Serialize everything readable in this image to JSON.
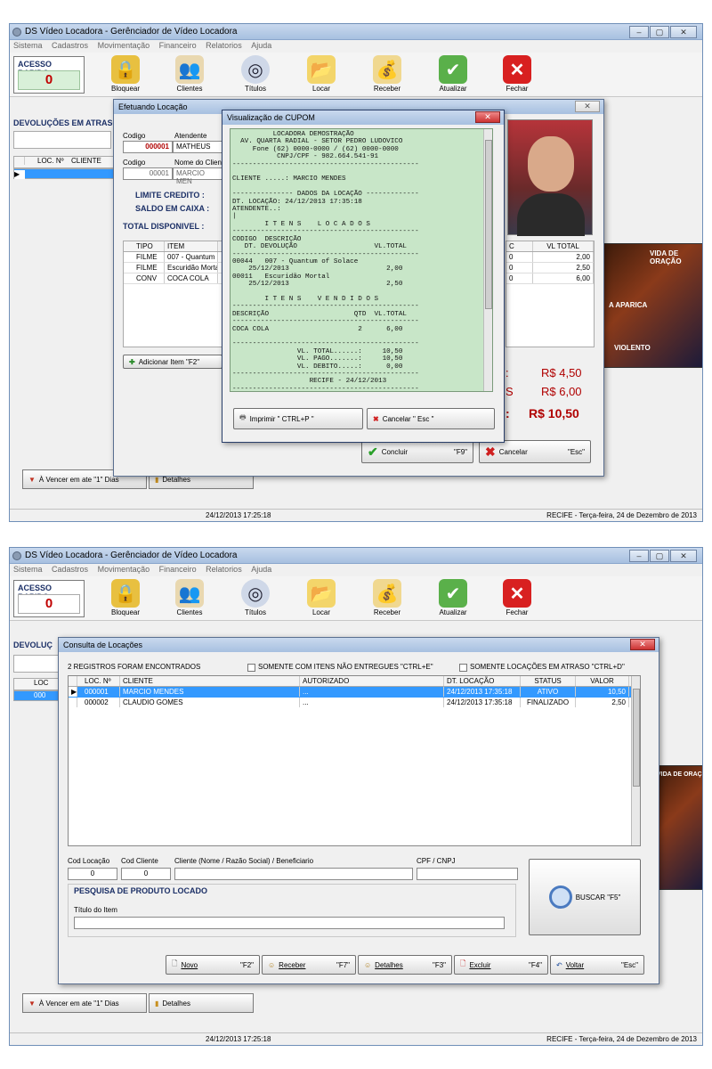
{
  "app": {
    "title": "DS Vídeo Locadora - Gerênciador de Vídeo Locadora",
    "menu": [
      "Sistema",
      "Cadastros",
      "Movimentação",
      "Financeiro",
      "Relatorios",
      "Ajuda"
    ],
    "acesso_rapido_label": "ACESSO RAPIDO",
    "acesso_rapido_value": "0",
    "toolbar": [
      {
        "label": "Bloquear",
        "icon": "padlock-icon"
      },
      {
        "label": "Clientes",
        "icon": "users-icon"
      },
      {
        "label": "Títulos",
        "icon": "dvd-icon"
      },
      {
        "label": "Locar",
        "icon": "folder-icon"
      },
      {
        "label": "Receber",
        "icon": "coins-icon"
      },
      {
        "label": "Atualizar",
        "icon": "shield-check-icon"
      },
      {
        "label": "Fechar",
        "icon": "close-x-icon"
      }
    ],
    "win_buttons": [
      "–",
      "▢",
      "✕"
    ],
    "status_datetime": "24/12/2013 17:25:18",
    "status_location": "RECIFE - Terça-feira, 24 de Dezembro de 2013",
    "left_panel_title": "DEVOLUÇÕES EM ATRASO",
    "left_panel_title_short": "DEVOLUÇ",
    "left_grid_headers": [
      "LOC. Nº",
      "CLIENTE"
    ],
    "left_grid_headers_short": "LOC",
    "left_grid_cell_short": "000",
    "vencer_btn": "À Vencer em ate \"1\" Dias",
    "detalhes_btn": "Detalhes"
  },
  "locacao": {
    "title": "Efetuando Locação",
    "close": "✕",
    "codigo_label": "Codigo",
    "atendente_label": "Atendente",
    "codigo_value": "000001",
    "atendente_value": "MATHEUS",
    "codigo2_label": "Codigo",
    "nome_label": "Nome do Clien",
    "codigo2_value": "00001",
    "nome_value": "MARCIO MEN",
    "limite_label": "LIMITE CREDITO :",
    "saldo_label": "SALDO EM CAIXA :",
    "disponivel_label": "TOTAL DISPONIVEL :",
    "grid_headers": [
      "TIPO",
      "ITEM"
    ],
    "rows": [
      {
        "tipo": "FILME",
        "item": "007 - Quantum o"
      },
      {
        "tipo": "FILME",
        "item": "Escuridão Morta"
      },
      {
        "tipo": "CONV",
        "item": "COCA COLA"
      }
    ],
    "right_headers": [
      "C",
      "VL TOTAL"
    ],
    "right_rows": [
      {
        "c": "0",
        "v": "2,00"
      },
      {
        "c": "0",
        "v": "2,50"
      },
      {
        "c": "0",
        "v": "6,00"
      }
    ],
    "adicionar_label": "Adicionar Item   \"F2\"",
    "tot1_prefix": ":",
    "tot1": "R$ 4,50",
    "tot2_prefix": "S",
    "tot2": "R$ 6,00",
    "tot3_prefix": ":",
    "tot3": "R$ 10,50",
    "concluir_label": "Concluir",
    "concluir_key": "\"F9\"",
    "cancelar_label": "Cancelar",
    "cancelar_key": "\"Esc\""
  },
  "cupom": {
    "title": "Visualização de CUPOM",
    "lines": [
      "          LOCADORA DEMOSTRAÇÃO",
      "  AV. QUARTA RADIAL - SETOR PEDRO LUDOVICO",
      "     Fone (62) 0000-0000 / (62) 0000-0000",
      "           CNPJ/CPF - 982.664.541-91",
      "----------------------------------------------",
      "",
      "CLIENTE .....: MARCIO MENDES",
      "",
      "--------------- DADOS DA LOCAÇÃO -------------",
      "DT. LOCAÇÃO: 24/12/2013 17:35:18",
      "ATENDENTE..:",
      "|",
      "        I T E N S    L O C A D O S",
      "----------------------------------------------",
      "CODIGO  DESCRIÇÃO",
      "   DT. DEVOLUÇÃO                   VL.TOTAL",
      "----------------------------------------------",
      "00044   007 - Quantum of Solace",
      "    25/12/2013                        2,00",
      "00011   Escuridão Mortal",
      "    25/12/2013                        2,50",
      "",
      "        I T E N S    V E N D I D O S",
      "----------------------------------------------",
      "DESCRIÇÃO                     QTD  VL.TOTAL",
      "----------------------------------------------",
      "COCA COLA                      2      6,00",
      "",
      "----------------------------------------------",
      "                VL. TOTAL......:     10,50",
      "                VL. PAGO.......:     10,50",
      "                VL. DEBITO.....:      0,00",
      "----------------------------------------------",
      "                   RECIFE - 24/12/2013",
      "----------------------------------------------"
    ],
    "imprimir": "Imprimir \" CTRL+P \"",
    "cancelar": "Cancelar \" Esc \""
  },
  "consulta": {
    "title": "Consulta de Locações",
    "registros": "2 REGISTROS FORAM ENCONTRADOS",
    "chk1": "SOMENTE COM ITENS NÃO ENTREGUES  \"CTRL+E\"",
    "chk2": "SOMENTE LOCAÇÕES EM ATRASO \"CTRL+D\"",
    "headers": [
      "LOC. Nº",
      "CLIENTE",
      "AUTORIZADO",
      "DT. LOCAÇÃO",
      "STATUS",
      "VALOR"
    ],
    "rows": [
      {
        "loc": "000001",
        "cliente": "MARCIO MENDES",
        "aut": "...",
        "dt": "24/12/2013 17:35:18",
        "status": "ATIVO",
        "valor": "10,50"
      },
      {
        "loc": "000002",
        "cliente": "CLAUDIO GOMES",
        "aut": "...",
        "dt": "24/12/2013 17:35:18",
        "status": "FINALIZADO",
        "valor": "2,50"
      }
    ],
    "cod_locacao_label": "Cod Locação",
    "cod_cliente_label": "Cod Cliente",
    "cliente_label": "Cliente (Nome / Razão Social) / Beneficiario",
    "cpf_label": "CPF / CNPJ",
    "cod_locacao_value": "0",
    "cod_cliente_value": "0",
    "pesquisa_title": "PESQUISA DE PRODUTO LOCADO",
    "titulo_item_label": "Título do Item",
    "buscar": "BUSCAR \"F5\"",
    "buttons": [
      {
        "label": "Novo",
        "key": "\"F2\""
      },
      {
        "label": "Receber",
        "key": "\"F7\""
      },
      {
        "label": "Detalhes",
        "key": "\"F3\""
      },
      {
        "label": "Excluir",
        "key": "\"F4\""
      },
      {
        "label": "Voltar",
        "key": "\"Esc\""
      }
    ]
  },
  "posters": {
    "caption1": "VIDA DE ORAÇÃO",
    "caption2": "A APARICA",
    "caption3": "VIOLENTO"
  }
}
